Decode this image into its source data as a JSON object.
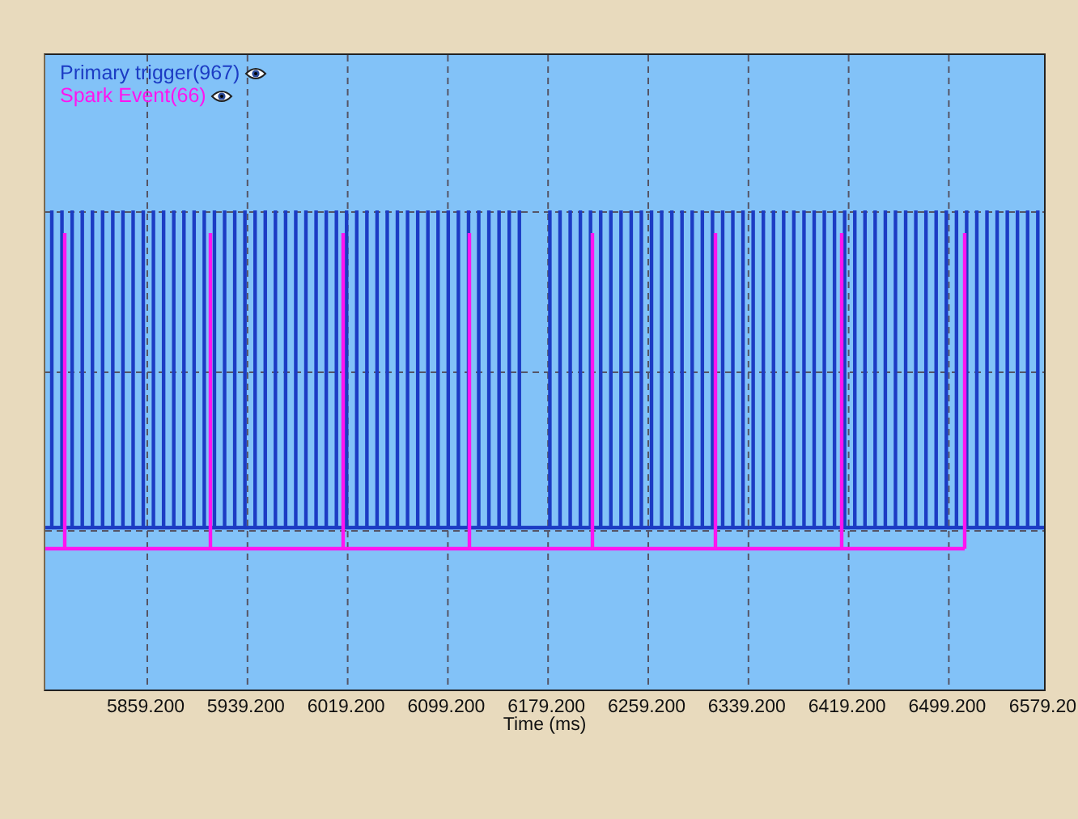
{
  "legend": [
    {
      "label": "Primary trigger(967)",
      "color": "#1c3cc4"
    },
    {
      "label": "Spark Event(66)",
      "color": "#ff14f0"
    }
  ],
  "x_ticks": [
    "5859.200",
    "5939.200",
    "6019.200",
    "6099.200",
    "6179.200",
    "6259.200",
    "6339.200",
    "6419.200",
    "6499.200",
    "6579.20"
  ],
  "x_axis_title": "Time (ms)"
}
